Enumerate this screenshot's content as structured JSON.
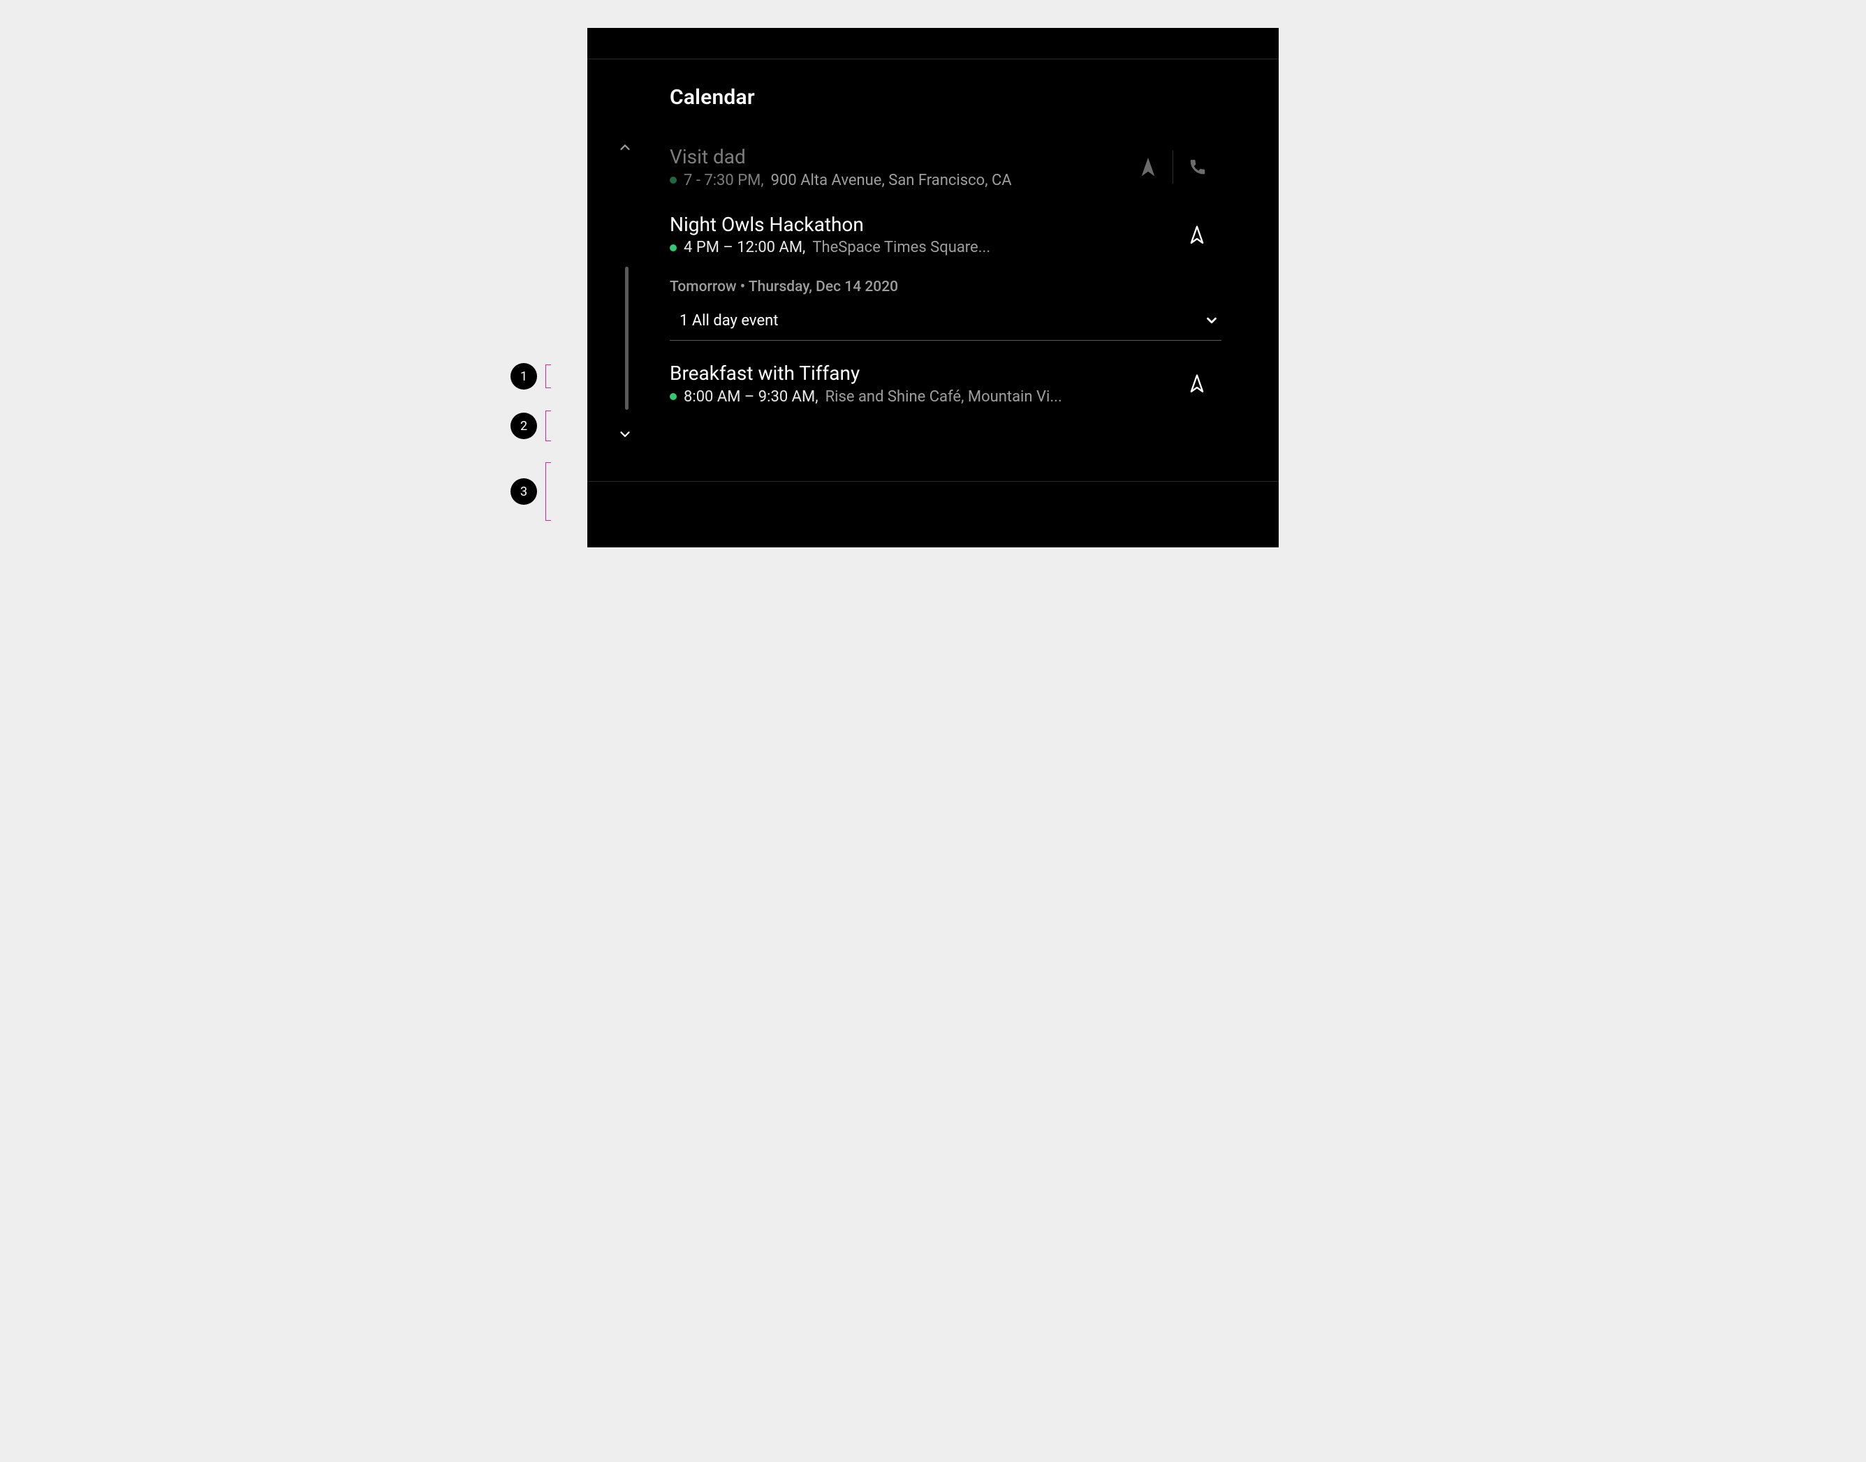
{
  "app_title": "Calendar",
  "events": [
    {
      "title": "Visit dad",
      "time": "7 - 7:30 PM,",
      "location": "900 Alta Avenue, San Francisco, CA",
      "dimmed": true,
      "has_phone": true
    },
    {
      "title": "Night Owls Hackathon",
      "time": "4 PM – 12:00 AM,",
      "location": "TheSpace Times Square...",
      "dimmed": false,
      "has_phone": false
    }
  ],
  "section_header": "Tomorrow • Thursday, Dec 14 2020",
  "all_day_row": "1 All day event",
  "tomorrow_events": [
    {
      "title": "Breakfast with Tiffany",
      "time": "8:00 AM – 9:30 AM,",
      "location": "Rise and Shine Café, Mountain Vi...",
      "dimmed": false,
      "has_phone": false
    }
  ],
  "annotations": [
    "1",
    "2",
    "3"
  ]
}
